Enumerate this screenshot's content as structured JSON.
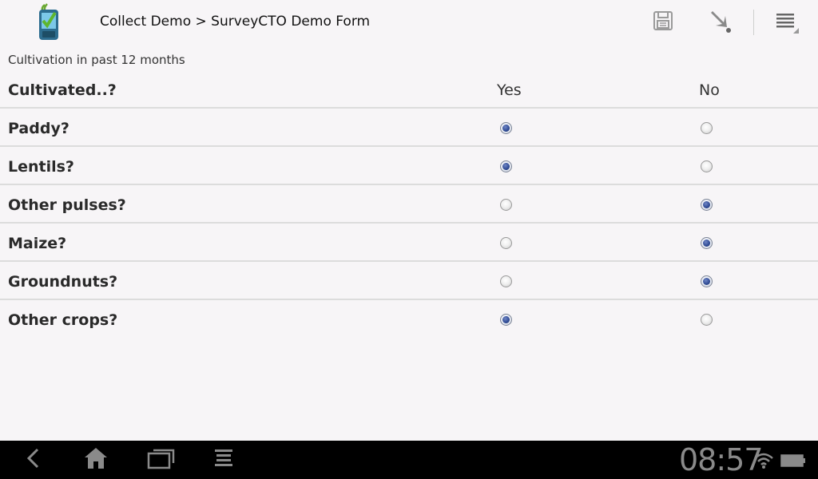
{
  "actionbar": {
    "title": "Collect Demo > SurveyCTO Demo Form",
    "icons": [
      "app-logo-icon",
      "save-icon",
      "download-icon",
      "overflow-menu-icon"
    ]
  },
  "form": {
    "group_label": "Cultivation in past 12 months",
    "header": {
      "question": "Cultivated..?",
      "col_yes": "Yes",
      "col_no": "No"
    },
    "rows": [
      {
        "label": "Paddy?",
        "answer": "Yes"
      },
      {
        "label": "Lentils?",
        "answer": "Yes"
      },
      {
        "label": "Other pulses?",
        "answer": "No"
      },
      {
        "label": "Maize?",
        "answer": "No"
      },
      {
        "label": "Groundnuts?",
        "answer": "No"
      },
      {
        "label": "Other crops?",
        "answer": "Yes"
      }
    ]
  },
  "statusbar": {
    "time": "08:57",
    "icons": [
      "back-icon",
      "home-icon",
      "recent-apps-icon",
      "menu-icon",
      "wifi-icon",
      "battery-icon"
    ]
  },
  "colors": {
    "radio_selected": "#2f4a93",
    "nav_background": "#000000",
    "background": "#f7f5f7"
  }
}
